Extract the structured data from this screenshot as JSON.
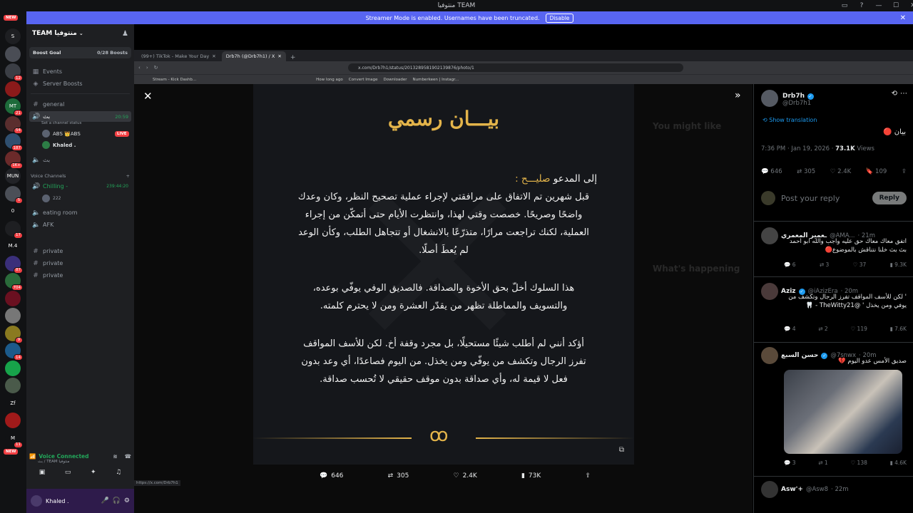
{
  "window": {
    "title": "منتوفيا TEAM",
    "controls": [
      "—",
      "☐",
      "✕"
    ]
  },
  "streamer_banner": {
    "text": "Streamer Mode is enabled. Usernames have been truncated.",
    "button": "Disable"
  },
  "rail": {
    "new_top": "NEW",
    "new_bottom": "NEW",
    "servers": [
      {
        "label": "S",
        "color": "#1e1f22",
        "badge": ""
      },
      {
        "label": "",
        "color": "#4a4d55",
        "badge": ""
      },
      {
        "label": "",
        "color": "#3b3e45",
        "badge": "12"
      },
      {
        "label": "",
        "color": "#8b1a1a",
        "badge": ""
      },
      {
        "label": "MT",
        "color": "#1d6b3a",
        "badge": "21"
      },
      {
        "label": "",
        "color": "#5a2e2e",
        "badge": "54"
      },
      {
        "label": "",
        "color": "#2f4f6f",
        "badge": "187"
      },
      {
        "label": "",
        "color": "#6b2a2a",
        "badge": "1K+"
      },
      {
        "label": "MUN",
        "color": "#222327",
        "badge": ""
      },
      {
        "label": "",
        "color": "#4b4f57",
        "badge": "5"
      },
      {
        "label": "0",
        "color": "#111214",
        "badge": ""
      },
      {
        "label": "",
        "color": "#1e1f22",
        "badge": "17"
      },
      {
        "label": "M.4",
        "color": "#111214",
        "badge": ""
      },
      {
        "label": "",
        "color": "#3a2f7a",
        "badge": "87"
      },
      {
        "label": "",
        "color": "#2a6a3a",
        "badge": "704"
      },
      {
        "label": "",
        "color": "#6a1020",
        "badge": ""
      },
      {
        "label": "",
        "color": "#777",
        "badge": ""
      },
      {
        "label": "",
        "color": "#8a7a20",
        "badge": "9"
      },
      {
        "label": "",
        "color": "#1c5a8a",
        "badge": "14"
      },
      {
        "label": "",
        "color": "#17a34a",
        "badge": ""
      },
      {
        "label": "",
        "color": "#4a5a4a",
        "badge": ""
      },
      {
        "label": "Zf",
        "color": "#111214",
        "badge": ""
      },
      {
        "label": "",
        "color": "#a01a1a",
        "badge": ""
      },
      {
        "label": "M",
        "color": "#111214",
        "badge": "11"
      }
    ]
  },
  "sidebar": {
    "server_name": "TEAM منتوفيا",
    "boost_goal": "Boost Goal",
    "boost_count": "0/28 Boosts",
    "events": "Events",
    "server_boosts": "Server Boosts",
    "channels": [
      {
        "name": "general",
        "type": "text"
      },
      {
        "name": "بث",
        "type": "voice-active",
        "time": "20:59",
        "status": "Set a channel status"
      }
    ],
    "stream_users": [
      {
        "name": "ABS 👑ABS",
        "live": "LIVE"
      },
      {
        "name": "Khaled ."
      }
    ],
    "channel_bt": "بث",
    "voice_category": "Voice Channels",
    "chilling": "Chilling -",
    "chilling_time": "239:44:20",
    "chilling_user": "222",
    "eating_room": "eating room",
    "afk": "AFK",
    "private_channels": [
      "private",
      "private",
      "private"
    ],
    "voice_connected": "Voice Connected",
    "voice_sub": "بث / TEAM منتوفيا",
    "user_name": "Khaled ."
  },
  "browser": {
    "tabs": [
      {
        "label": "(99+) TikTok - Make Your Day",
        "active": false
      },
      {
        "label": "Drb7h (@Drb7h1) / X",
        "active": true
      }
    ],
    "url": "x.com/Drb7h1/status/2013289581902139876/photo/1",
    "bookmarks": [
      "Stream - Kick Dashb...",
      "How long ago",
      "Convert Image",
      "Downloader",
      "Numberkeen | Instagr..."
    ],
    "status_url": "https://x.com/Drb7h1"
  },
  "post_image": {
    "title": "بيـــان رسمي",
    "greeting_prefix": "إلى المدعو",
    "greeting_name": "صليـــح :",
    "paragraph1": "قبل شهرين تم الاتفاق على مرافقتي لإجراء عملية تصحيح النظر، وكان وعدك واضحًا وصريحًا. خصصت وقتي لهذا، وانتظرت الأيام حتى أتمكّن من إجراء العملية، لكنك تراجعت مرارًا، متذرّعًا بالانشغال أو تتجاهل الطلب، وكأن الوعد لم يُعطَ أصلًا.",
    "paragraph2": "هذا السلوك أخلّ بحق الأخوة والصداقة. فالصديق الوفي يوفّي بوعده، والتسويف والمماطلة تظهر من يقدّر العشرة ومن لا يحترم كلمته.",
    "paragraph3": "أؤكد أنني لم أطلب شيئًا مستحيلًا، بل مجرد وقفة أخ. لكن للأسف المواقف تفرز الرجال وتكشف من يوفّي ومن يخذل. من اليوم فصاعدًا، أي وعد بدون فعل لا قيمة له، وأي صداقة بدون موقف حقيقي لا تُحسب صداقة."
  },
  "media_actions": {
    "replies": "646",
    "reposts": "305",
    "likes": "2.4K",
    "views": "73K"
  },
  "tweet": {
    "author": "Drb7h",
    "handle": "@Drb7h1",
    "show_translation": "Show translation",
    "text": "بيان 🔴",
    "timestamp": "7:36 PM · Jan 19, 2026 · ",
    "views": "73.1K",
    "views_label": " Views",
    "stats": {
      "replies": "646",
      "reposts": "305",
      "likes": "2.4K",
      "bookmarks": "109"
    },
    "reply_placeholder": "Post your reply",
    "reply_button": "Reply"
  },
  "replies": [
    {
      "name": "ـعمير المعمري",
      "handle": "@AMA...",
      "time": "· 21m",
      "text": "اتفق معاك معاك حق عليه واجب والله ابو احمد بث بث خلنا نتناقش بالموضوع🔴",
      "stats": {
        "replies": "6",
        "reposts": "3",
        "likes": "37",
        "views": "9.3K"
      }
    },
    {
      "name": "Aziz",
      "handle": "@iAzizEra",
      "time": "· 20m",
      "text": "' لكن للأسف المواقف تفرز الرجال وتكشف من يوفي ومن يخذل ' @TheWitty21 - 🦷",
      "stats": {
        "replies": "4",
        "reposts": "2",
        "likes": "119",
        "views": "7.6K"
      }
    },
    {
      "name": "حسن السبع",
      "handle": "@7snwx",
      "time": "· 20m",
      "text": "صديق الأمس عدو اليوم 💔",
      "stats": {
        "replies": "3",
        "reposts": "1",
        "likes": "138",
        "views": "4.6K"
      }
    },
    {
      "name": "Asw'+",
      "handle": "@Asw8",
      "time": "· 22m",
      "text": "",
      "stats": {}
    }
  ],
  "ghost_panel": {
    "you_might_like": "You might like",
    "whats_happening": "What's happening"
  },
  "colors": {
    "accent": "#5865f2",
    "gold": "#e3b44a",
    "x_blue": "#1d9bf0",
    "live_red": "#f23f43"
  }
}
